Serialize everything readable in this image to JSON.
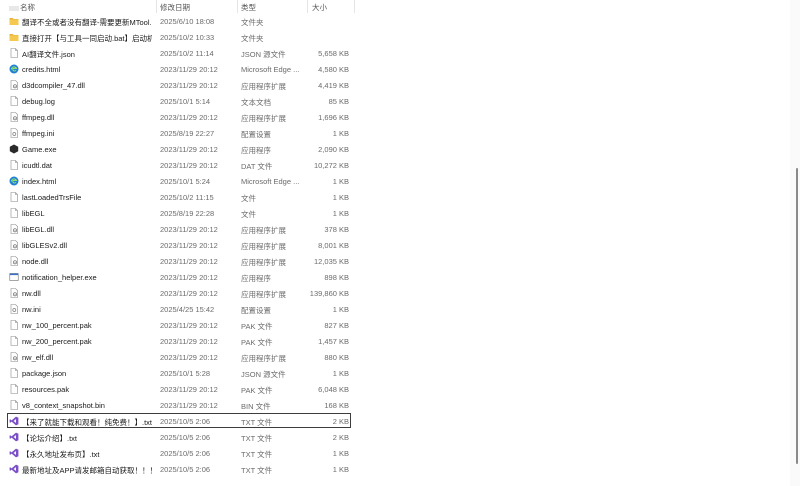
{
  "columns": {
    "name": "名称",
    "date": "修改日期",
    "type": "类型",
    "size": "大小"
  },
  "files": [
    {
      "name": "翻译不全或者没有翻译-需要更新MTool...",
      "date": "2025/6/10 18:08",
      "type": "文件夹",
      "size": "",
      "icon": "folder-icon"
    },
    {
      "name": "直接打开【与工具一同启动.bat】启动机翻",
      "date": "2025/10/2 10:33",
      "type": "文件夹",
      "size": "",
      "icon": "folder-icon"
    },
    {
      "name": "AI翻译文件.json",
      "date": "2025/10/2 11:14",
      "type": "JSON 源文件",
      "size": "5,658 KB",
      "icon": "document-icon"
    },
    {
      "name": "credits.html",
      "date": "2023/11/29 20:12",
      "type": "Microsoft Edge ...",
      "size": "4,580 KB",
      "icon": "edge-icon"
    },
    {
      "name": "d3dcompiler_47.dll",
      "date": "2023/11/29 20:12",
      "type": "应用程序扩展",
      "size": "4,419 KB",
      "icon": "dll-icon"
    },
    {
      "name": "debug.log",
      "date": "2025/10/1 5:14",
      "type": "文本文档",
      "size": "85 KB",
      "icon": "document-icon"
    },
    {
      "name": "ffmpeg.dll",
      "date": "2023/11/29 20:12",
      "type": "应用程序扩展",
      "size": "1,696 KB",
      "icon": "dll-icon"
    },
    {
      "name": "ffmpeg.ini",
      "date": "2025/8/19 22:27",
      "type": "配置设置",
      "size": "1 KB",
      "icon": "ini-icon"
    },
    {
      "name": "Game.exe",
      "date": "2023/11/29 20:12",
      "type": "应用程序",
      "size": "2,090 KB",
      "icon": "game-exe-icon"
    },
    {
      "name": "icudtl.dat",
      "date": "2023/11/29 20:12",
      "type": "DAT 文件",
      "size": "10,272 KB",
      "icon": "document-icon"
    },
    {
      "name": "index.html",
      "date": "2025/10/1 5:24",
      "type": "Microsoft Edge ...",
      "size": "1 KB",
      "icon": "edge-icon"
    },
    {
      "name": "lastLoadedTrsFile",
      "date": "2025/10/2 11:15",
      "type": "文件",
      "size": "1 KB",
      "icon": "document-icon"
    },
    {
      "name": "libEGL",
      "date": "2025/8/19 22:28",
      "type": "文件",
      "size": "1 KB",
      "icon": "document-icon"
    },
    {
      "name": "libEGL.dll",
      "date": "2023/11/29 20:12",
      "type": "应用程序扩展",
      "size": "378 KB",
      "icon": "dll-icon"
    },
    {
      "name": "libGLESv2.dll",
      "date": "2023/11/29 20:12",
      "type": "应用程序扩展",
      "size": "8,001 KB",
      "icon": "dll-icon"
    },
    {
      "name": "node.dll",
      "date": "2023/11/29 20:12",
      "type": "应用程序扩展",
      "size": "12,035 KB",
      "icon": "dll-icon"
    },
    {
      "name": "notification_helper.exe",
      "date": "2023/11/29 20:12",
      "type": "应用程序",
      "size": "898 KB",
      "icon": "exe-icon"
    },
    {
      "name": "nw.dll",
      "date": "2023/11/29 20:12",
      "type": "应用程序扩展",
      "size": "139,860 KB",
      "icon": "dll-icon"
    },
    {
      "name": "nw.ini",
      "date": "2025/4/25 15:42",
      "type": "配置设置",
      "size": "1 KB",
      "icon": "ini-icon"
    },
    {
      "name": "nw_100_percent.pak",
      "date": "2023/11/29 20:12",
      "type": "PAK 文件",
      "size": "827 KB",
      "icon": "document-icon"
    },
    {
      "name": "nw_200_percent.pak",
      "date": "2023/11/29 20:12",
      "type": "PAK 文件",
      "size": "1,457 KB",
      "icon": "document-icon"
    },
    {
      "name": "nw_elf.dll",
      "date": "2023/11/29 20:12",
      "type": "应用程序扩展",
      "size": "880 KB",
      "icon": "dll-icon"
    },
    {
      "name": "package.json",
      "date": "2025/10/1 5:28",
      "type": "JSON 源文件",
      "size": "1 KB",
      "icon": "document-icon"
    },
    {
      "name": "resources.pak",
      "date": "2023/11/29 20:12",
      "type": "PAK 文件",
      "size": "6,048 KB",
      "icon": "document-icon"
    },
    {
      "name": "v8_context_snapshot.bin",
      "date": "2023/11/29 20:12",
      "type": "BIN 文件",
      "size": "168 KB",
      "icon": "document-icon"
    },
    {
      "name": "【来了就能下载和观看！纯免费！】.txt",
      "date": "2025/10/5 2:06",
      "type": "TXT 文件",
      "size": "2 KB",
      "icon": "vs-txt-icon",
      "selected": true
    },
    {
      "name": "【论坛介绍】.txt",
      "date": "2025/10/5 2:06",
      "type": "TXT 文件",
      "size": "2 KB",
      "icon": "vs-txt-icon"
    },
    {
      "name": "【永久地址发布页】.txt",
      "date": "2025/10/5 2:06",
      "type": "TXT 文件",
      "size": "1 KB",
      "icon": "vs-txt-icon"
    },
    {
      "name": "最新地址及APP请发邮箱自动获取！！！...",
      "date": "2025/10/5 2:06",
      "type": "TXT 文件",
      "size": "1 KB",
      "icon": "vs-txt-icon"
    }
  ],
  "colors": {
    "folder": "#e8b33c",
    "edge": "#1f7fd6",
    "vs": "#7b4fc7",
    "game": "#2a2a2a"
  }
}
